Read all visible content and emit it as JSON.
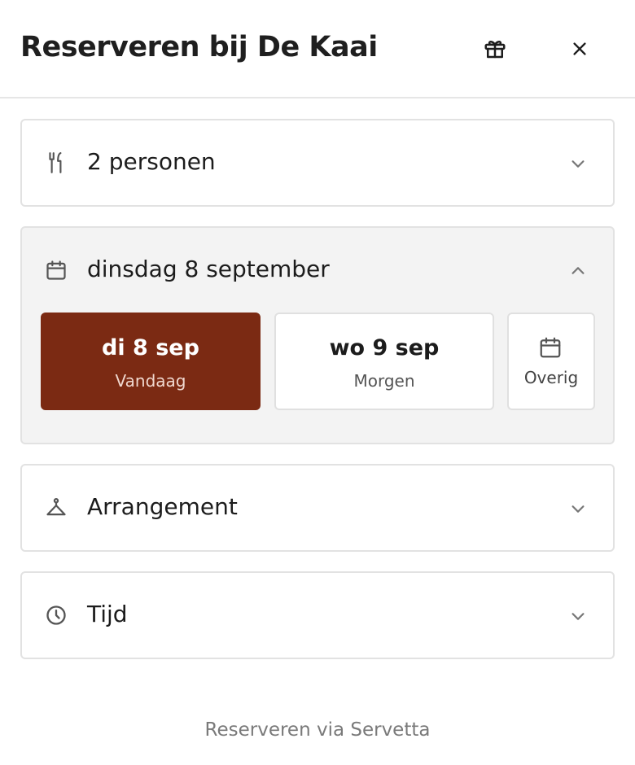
{
  "header": {
    "title": "Reserveren bij De Kaai",
    "gift_icon": "gift-icon",
    "close_icon": "close-icon"
  },
  "sections": {
    "guests": {
      "label": "2 personen",
      "icon": "cutlery-icon",
      "expanded": false
    },
    "date": {
      "label": "dinsdag 8 september",
      "icon": "calendar-icon",
      "expanded": true,
      "options": [
        {
          "day": "di 8 sep",
          "sub": "Vandaag",
          "selected": true
        },
        {
          "day": "wo 9 sep",
          "sub": "Morgen",
          "selected": false
        }
      ],
      "other_label": "Overig"
    },
    "arrangement": {
      "label": "Arrangement",
      "icon": "hanger-icon",
      "expanded": false
    },
    "time": {
      "label": "Tijd",
      "icon": "clock-icon",
      "expanded": false
    }
  },
  "footer": {
    "text": "Reserveren via Servetta"
  },
  "colors": {
    "accent": "#7b2a13",
    "card_border": "#e2e2e2",
    "open_card_bg": "#f3f3f3"
  }
}
